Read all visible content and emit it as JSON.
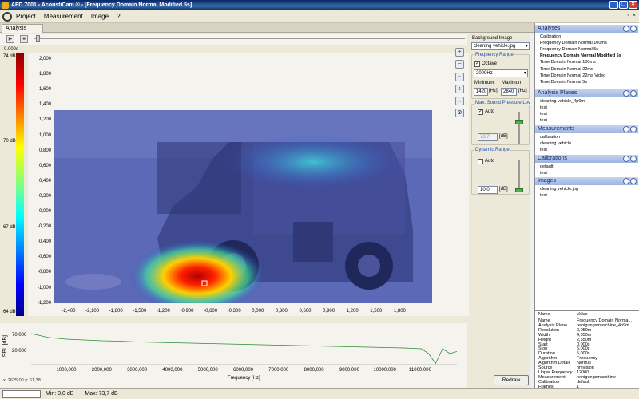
{
  "window": {
    "title": "AFD 7001 - AcoustiCam ® - [Frequency Domain Normal Modified 5s]"
  },
  "menu": [
    "Project",
    "Measurement",
    "Image",
    "?"
  ],
  "menu_right": [
    "_",
    "▫",
    "×"
  ],
  "tab": "Analysis",
  "time_value": "0.000s",
  "colorbar": {
    "labels": [
      "74 dB",
      "70 dB",
      "67 dB",
      "64 dB"
    ]
  },
  "main_plot": {
    "y_ticks": [
      "2,000",
      "1,800",
      "1,600",
      "1,400",
      "1,200",
      "1,000",
      "0,800",
      "0,600",
      "0,400",
      "0,200",
      "0,000",
      "-0,200",
      "-0,400",
      "-0,600",
      "-0,800",
      "-1,000",
      "-1,200"
    ],
    "x_ticks": [
      "-2,400",
      "-2,100",
      "-1,800",
      "-1,500",
      "-1,200",
      "-0,900",
      "-0,600",
      "-0,300",
      "0,000",
      "0,300",
      "0,600",
      "0,900",
      "1,200",
      "1,500",
      "1,800"
    ]
  },
  "controls": {
    "background_image_label": "Background Image",
    "background_image_value": "cleaning vehicle.jpg",
    "frequency_range_label": "Frequency Range",
    "octave_label": "Octave",
    "octave_checked": true,
    "octave_value": "2000Hz",
    "minimum_label": "Minimum",
    "maximum_label": "Maximum",
    "minimum_value": "1420",
    "maximum_value": "2840",
    "unit_hz": "[Hz]",
    "max_spl_label": "Max. Sound Pressure Level",
    "auto_label": "Auto",
    "max_spl_auto": true,
    "max_spl_value": "73,7",
    "unit_db": "[dB]",
    "dynamic_range_label": "Dynamic Range",
    "dynamic_auto": false,
    "dynamic_value": "10,0"
  },
  "spl_chart": {
    "ylabel": "SPL [dB]",
    "y_ticks": [
      "70,000",
      "20,000"
    ],
    "x_ticks": [
      "1000,000",
      "2000,000",
      "3000,000",
      "4000,000",
      "5000,000",
      "6000,000",
      "7000,000",
      "8000,000",
      "9000,000",
      "10000,000",
      "11000,000"
    ],
    "xlabel": "Frequency [Hz]",
    "coord_text": "x: 2625,00 y: 61,38",
    "redraw_label": "Redraw"
  },
  "chart_data": {
    "type": "line",
    "xlabel": "Frequency [Hz]",
    "ylabel": "SPL [dB]",
    "x": [
      0,
      500,
      1000,
      1500,
      2000,
      2500,
      3000,
      3500,
      4000,
      4500,
      5000,
      5500,
      6000,
      6500,
      7000,
      7500,
      8000,
      8500,
      9000,
      9500,
      10000,
      10500,
      11000,
      11200,
      11400,
      11600,
      11800,
      12000
    ],
    "series": [
      {
        "values": [
          80,
          70,
          66,
          64,
          62,
          61,
          59,
          58,
          57,
          56,
          55,
          54,
          53,
          52,
          51,
          50,
          49,
          48,
          47,
          46,
          45,
          44,
          42,
          30,
          5,
          42,
          30,
          35
        ]
      }
    ],
    "ylim": [
      0,
      90
    ]
  },
  "status": {
    "min": "Min: 0,0 dB",
    "max": "Max: 73,7 dB"
  },
  "right_panel": {
    "analyses_title": "Analyses",
    "analyses": [
      "Calibration",
      "Frequency Domain Normal 100ms",
      "Frequency Domain Normal 5s",
      "Frequency Domain Normal Modified 5s",
      "Time Domain Normal 100ms",
      "Time Domain Normal 22ms",
      "Time Domain Normal 22ms Video",
      "Time Domain Normal 5s"
    ],
    "active_analysis": 3,
    "planes_title": "Analysis Planes",
    "planes": [
      "cleaning vehicle_4p9m",
      "test",
      "test",
      "test"
    ],
    "measurements_title": "Measurements",
    "measurements": [
      "calibration",
      "cleaning vehicle",
      "test"
    ],
    "calibrations_title": "Calibrations",
    "calibrations": [
      "default",
      "test"
    ],
    "images_title": "Images",
    "images": [
      "cleaning vehicle.jpg",
      "test"
    ]
  },
  "properties": {
    "header": [
      "Name",
      "Value"
    ],
    "rows": [
      [
        "Name",
        "Frequency Domain Norma..."
      ],
      [
        "Analysis Plane",
        "reinigungsmaschine_4p9m"
      ],
      [
        "Resolution",
        "0,050m"
      ],
      [
        "Width",
        "4,850m"
      ],
      [
        "Height",
        "2,550m"
      ],
      [
        "Start",
        "0,000s"
      ],
      [
        "Stop",
        "5,000s"
      ],
      [
        "Duration",
        "5,000s"
      ],
      [
        "Algorithm",
        "Frequency"
      ],
      [
        "Algorithm Detail",
        "Normal"
      ],
      [
        "Source",
        "hmvision"
      ],
      [
        "Upper Frequency",
        "12000"
      ],
      [
        "Measurement",
        "reinigungsmaschine"
      ],
      [
        "Calibration",
        "default"
      ],
      [
        "Frames",
        "1"
      ]
    ]
  },
  "colors": {
    "accent": "#1d50b0",
    "titlebar": "#0a246a",
    "line": "#2e8b2e"
  }
}
